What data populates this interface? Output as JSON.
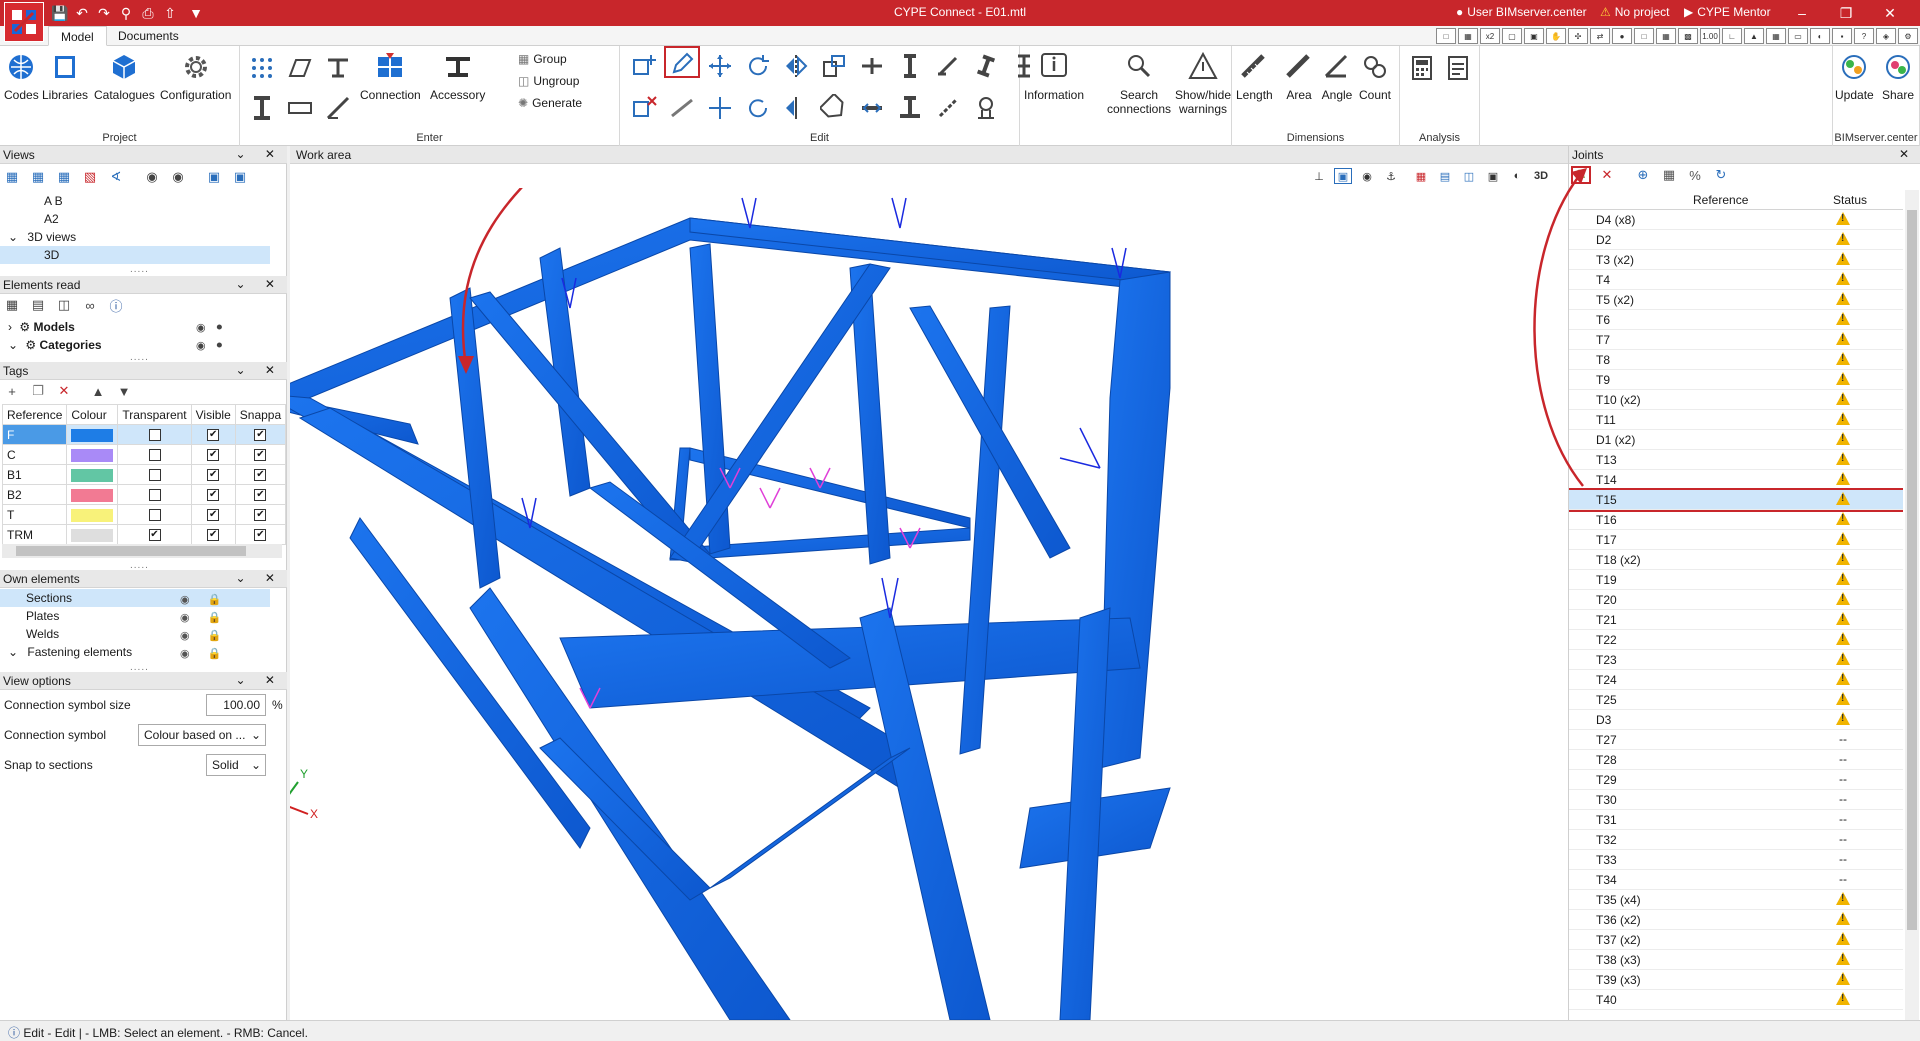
{
  "window": {
    "title": "CYPE Connect - E01.mtl",
    "user": "User BIMserver.center",
    "project": "No project",
    "mentor": "CYPE Mentor"
  },
  "ribbon_tabs": [
    "Model",
    "Documents"
  ],
  "ribbon": {
    "project": {
      "label": "Project",
      "buttons": [
        "Codes",
        "Libraries",
        "Catalogues",
        "Configuration"
      ]
    },
    "enter": {
      "label": "Enter",
      "buttons": [
        "Connection",
        "Accessory"
      ],
      "small": [
        "Group",
        "Ungroup",
        "Generate"
      ]
    },
    "edit": {
      "label": "Edit"
    },
    "info": {
      "buttons": [
        "Information",
        "Search connections",
        "Show/hide warnings"
      ]
    },
    "dimensions": {
      "label": "Dimensions",
      "buttons": [
        "Length",
        "Area",
        "Angle",
        "Count"
      ]
    },
    "analysis": {
      "label": "Analysis"
    },
    "bim": {
      "label": "BIMserver.center",
      "buttons": [
        "Update",
        "Share"
      ]
    }
  },
  "panels": {
    "views": {
      "title": "Views",
      "items": [
        "A B",
        "A2",
        "3D views",
        "3D"
      ]
    },
    "elements_read": {
      "title": "Elements read",
      "items": [
        "Models",
        "Categories"
      ]
    },
    "tags": {
      "title": "Tags",
      "columns": [
        "Reference",
        "Colour",
        "Transparent",
        "Visible",
        "Snappa"
      ],
      "rows": [
        {
          "ref": "F",
          "colour": "#1e7de6",
          "transparent": false,
          "visible": true,
          "snap": true
        },
        {
          "ref": "C",
          "colour": "#a98af7",
          "transparent": false,
          "visible": true,
          "snap": true
        },
        {
          "ref": "B1",
          "colour": "#62c6a4",
          "transparent": false,
          "visible": true,
          "snap": true
        },
        {
          "ref": "B2",
          "colour": "#f27a93",
          "transparent": false,
          "visible": true,
          "snap": true
        },
        {
          "ref": "T",
          "colour": "#f8f27a",
          "transparent": false,
          "visible": true,
          "snap": true
        },
        {
          "ref": "TRM",
          "colour": "#dedede",
          "transparent": true,
          "visible": true,
          "snap": true
        }
      ]
    },
    "own_elements": {
      "title": "Own elements",
      "items": [
        "Sections",
        "Plates",
        "Welds",
        "Fastening elements"
      ]
    },
    "view_options": {
      "title": "View options",
      "symbol_size_label": "Connection symbol size",
      "symbol_size_value": "100.00",
      "symbol_size_unit": "%",
      "symbol_label": "Connection symbol",
      "symbol_value": "Colour based on ...",
      "snap_label": "Snap to sections",
      "snap_value": "Solid"
    }
  },
  "workarea": {
    "title": "Work area"
  },
  "joints": {
    "title": "Joints",
    "columns": [
      "Reference",
      "Status"
    ],
    "selected_index": 14,
    "rows": [
      {
        "ref": "D4 (x8)",
        "status": "warn"
      },
      {
        "ref": "D2",
        "status": "warn"
      },
      {
        "ref": "T3 (x2)",
        "status": "warn"
      },
      {
        "ref": "T4",
        "status": "warn"
      },
      {
        "ref": "T5 (x2)",
        "status": "warn"
      },
      {
        "ref": "T6",
        "status": "warn"
      },
      {
        "ref": "T7",
        "status": "warn"
      },
      {
        "ref": "T8",
        "status": "warn"
      },
      {
        "ref": "T9",
        "status": "warn"
      },
      {
        "ref": "T10 (x2)",
        "status": "warn"
      },
      {
        "ref": "T11",
        "status": "warn"
      },
      {
        "ref": "D1 (x2)",
        "status": "warn"
      },
      {
        "ref": "T13",
        "status": "warn"
      },
      {
        "ref": "T14",
        "status": "warn"
      },
      {
        "ref": "T15",
        "status": "warn"
      },
      {
        "ref": "T16",
        "status": "warn"
      },
      {
        "ref": "T17",
        "status": "warn"
      },
      {
        "ref": "T18 (x2)",
        "status": "warn"
      },
      {
        "ref": "T19",
        "status": "warn"
      },
      {
        "ref": "T20",
        "status": "warn"
      },
      {
        "ref": "T21",
        "status": "warn"
      },
      {
        "ref": "T22",
        "status": "warn"
      },
      {
        "ref": "T23",
        "status": "warn"
      },
      {
        "ref": "T24",
        "status": "warn"
      },
      {
        "ref": "T25",
        "status": "warn"
      },
      {
        "ref": "D3",
        "status": "warn"
      },
      {
        "ref": "T27",
        "status": "--"
      },
      {
        "ref": "T28",
        "status": "--"
      },
      {
        "ref": "T29",
        "status": "--"
      },
      {
        "ref": "T30",
        "status": "--"
      },
      {
        "ref": "T31",
        "status": "--"
      },
      {
        "ref": "T32",
        "status": "--"
      },
      {
        "ref": "T33",
        "status": "--"
      },
      {
        "ref": "T34",
        "status": "--"
      },
      {
        "ref": "T35 (x4)",
        "status": "warn"
      },
      {
        "ref": "T36 (x2)",
        "status": "warn"
      },
      {
        "ref": "T37 (x2)",
        "status": "warn"
      },
      {
        "ref": "T38 (x3)",
        "status": "warn"
      },
      {
        "ref": "T39 (x3)",
        "status": "warn"
      },
      {
        "ref": "T40",
        "status": "warn"
      }
    ]
  },
  "status_bar": "Edit - Edit |  - LMB: Select an element. - RMB: Cancel.",
  "colors": {
    "accent": "#c8262b",
    "structure": "#1566e0",
    "selection": "#cfe6fa"
  }
}
